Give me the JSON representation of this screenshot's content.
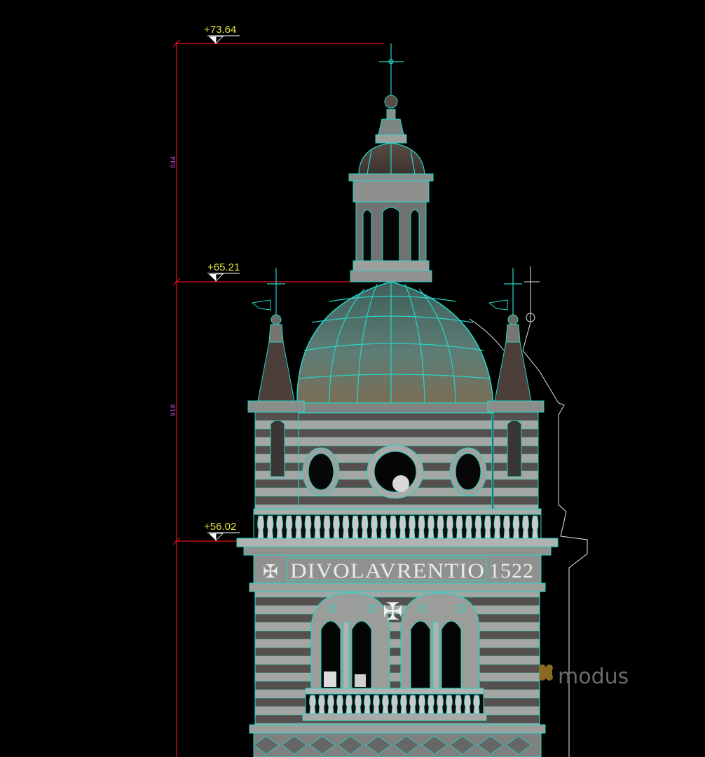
{
  "elevations": [
    {
      "label": "+73.64"
    },
    {
      "label": "+65.21"
    },
    {
      "label": "+56.02"
    }
  ],
  "dimensions": [
    {
      "label": "844"
    },
    {
      "label": "918"
    }
  ],
  "inscription": {
    "text": "DIVOLAVRENTIO",
    "year": "1522"
  },
  "logo": {
    "text": "modus"
  },
  "colors": {
    "background": "#000000",
    "dimension_line": "#e01020",
    "elevation_text": "#e0e040",
    "dimension_text": "#d040d0",
    "trace_lines": "#25d6c8",
    "stone_light": "#9a9e9c",
    "stone_dark": "#4e4a48",
    "copper": "#5d7a74"
  }
}
